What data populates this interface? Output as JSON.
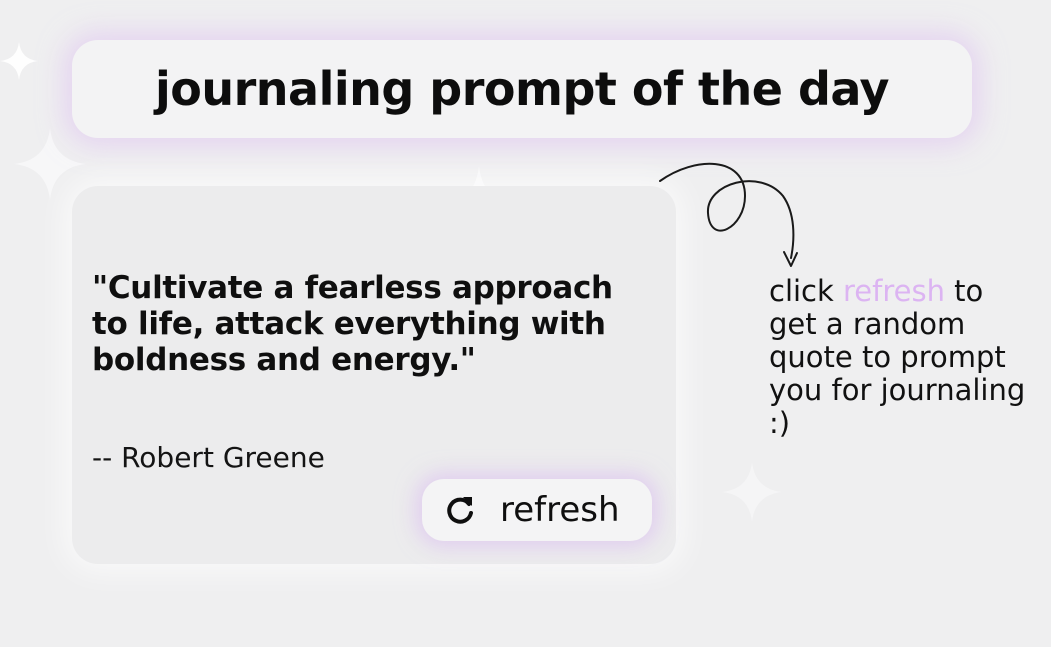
{
  "header": {
    "title": "journaling prompt of the day"
  },
  "quote": {
    "text": "\"Cultivate a fearless approach to life, attack everything with boldness and energy.\"",
    "author": "-- Robert Greene"
  },
  "refresh_button": {
    "label": "refresh",
    "icon": "refresh-icon"
  },
  "hint": {
    "before": "click ",
    "accent": "refresh",
    "after": " to get a random quote to prompt you for journaling :)"
  },
  "colors": {
    "background": "#efeff0",
    "card": "#f3f3f4",
    "accent": "#dcb4f2",
    "glow": "#dcbef0",
    "text": "#111111"
  },
  "decorations": {
    "sparkle_icon": "sparkle-icon",
    "arrow_icon": "curly-arrow-icon"
  }
}
